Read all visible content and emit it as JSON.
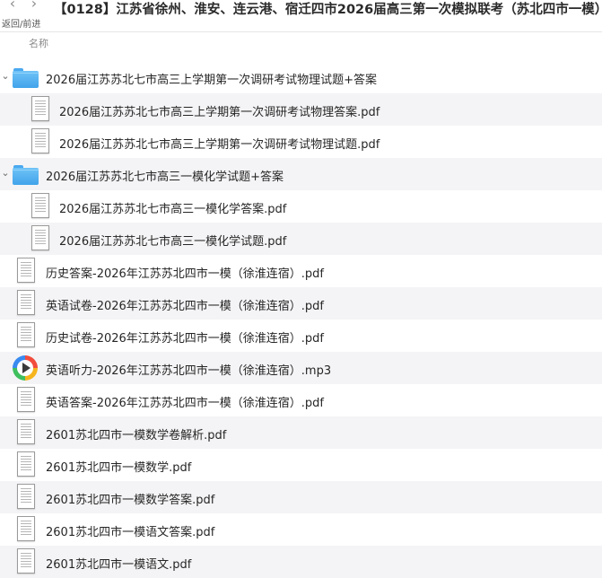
{
  "toolbar": {
    "back_icon": "chevron-left-icon",
    "forward_icon": "chevron-right-icon",
    "back_glyph": "‹",
    "forward_glyph": "›",
    "nav_label": "返回/前进",
    "title": "【0128】江苏省徐州、淮安、连云港、宿迁四市2026届高三第一次模拟联考（苏北四市一模）"
  },
  "columns": {
    "name": "名称"
  },
  "items": [
    {
      "label": "2026届江苏苏北七市高三上学期第一次调研考试物理试题+答案",
      "kind": "folder",
      "level": 0,
      "expanded": true,
      "disclosure": "⌄"
    },
    {
      "label": "2026届江苏苏北七市高三上学期第一次调研考试物理答案.pdf",
      "kind": "pdf",
      "level": 1
    },
    {
      "label": "2026届江苏苏北七市高三上学期第一次调研考试物理试题.pdf",
      "kind": "pdf",
      "level": 1
    },
    {
      "label": "2026届江苏苏北七市高三一模化学试题+答案",
      "kind": "folder",
      "level": 0,
      "expanded": true,
      "disclosure": "⌄"
    },
    {
      "label": "2026届江苏苏北七市高三一模化学答案.pdf",
      "kind": "pdf",
      "level": 1
    },
    {
      "label": "2026届江苏苏北七市高三一模化学试题.pdf",
      "kind": "pdf",
      "level": 1
    },
    {
      "label": "历史答案-2026年江苏苏北四市一模（徐淮连宿）.pdf",
      "kind": "pdf",
      "level": 0
    },
    {
      "label": "英语试卷-2026年江苏苏北四市一模（徐淮连宿）.pdf",
      "kind": "pdf",
      "level": 0
    },
    {
      "label": "历史试卷-2026年江苏苏北四市一模（徐淮连宿）.pdf",
      "kind": "pdf",
      "level": 0
    },
    {
      "label": "英语听力-2026年江苏苏北四市一模（徐淮连宿）.mp3",
      "kind": "mp3",
      "level": 0
    },
    {
      "label": "英语答案-2026年江苏苏北四市一模（徐淮连宿）.pdf",
      "kind": "pdf",
      "level": 0
    },
    {
      "label": "2601苏北四市一模数学卷解析.pdf",
      "kind": "pdf",
      "level": 0
    },
    {
      "label": "2601苏北四市一模数学.pdf",
      "kind": "pdf",
      "level": 0
    },
    {
      "label": "2601苏北四市一模数学答案.pdf",
      "kind": "pdf",
      "level": 0
    },
    {
      "label": "2601苏北四市一模语文答案.pdf",
      "kind": "pdf",
      "level": 0
    },
    {
      "label": "2601苏北四市一模语文.pdf",
      "kind": "pdf",
      "level": 0
    }
  ],
  "colors": {
    "folder": "#4aa8ef",
    "row_alt": "#f4f4f6",
    "text": "#262626",
    "muted": "#8a8a8a"
  }
}
